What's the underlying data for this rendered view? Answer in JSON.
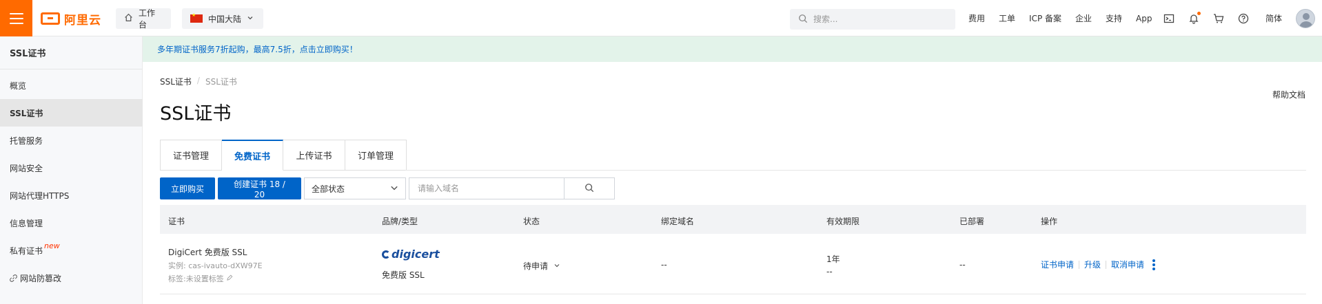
{
  "topbar": {
    "logo_text": "阿里云",
    "workbench": "工作台",
    "region": "中国大陆",
    "search_placeholder": "搜索...",
    "links": [
      "费用",
      "工单",
      "ICP 备案",
      "企业",
      "支持",
      "App"
    ],
    "language": "简体",
    "accent_color": "#ff6a00"
  },
  "sidebar": {
    "title": "SSL证书",
    "items": [
      {
        "label": "概览"
      },
      {
        "label": "SSL证书",
        "active": true
      },
      {
        "label": "托管服务"
      },
      {
        "label": "网站安全"
      },
      {
        "label": "网站代理HTTPS"
      },
      {
        "label": "信息管理"
      },
      {
        "label": "私有证书",
        "badge": "new"
      },
      {
        "label": "网站防篡改"
      }
    ]
  },
  "banner": {
    "text": "多年期证书服务7折起购，最高7.5折，点击立即购买！"
  },
  "breadcrumb": {
    "root": "SSL证书",
    "current": "SSL证书"
  },
  "help_doc": "帮助文档",
  "page_title": "SSL证书",
  "tabs": [
    {
      "label": "证书管理"
    },
    {
      "label": "免费证书",
      "active": true
    },
    {
      "label": "上传证书"
    },
    {
      "label": "订单管理"
    }
  ],
  "toolbar": {
    "buy_label": "立即购买",
    "create_label": "创建证书 18 / 20",
    "status_filter": "全部状态",
    "domain_placeholder": "请输入域名"
  },
  "table": {
    "headers": [
      "证书",
      "品牌/类型",
      "状态",
      "绑定域名",
      "有效期限",
      "已部署",
      "操作"
    ],
    "rows": [
      {
        "name": "DigiCert 免费版 SSL",
        "instance": "实例: cas-ivauto-dXW97E",
        "tag": "标签:未设置标签",
        "brand": "digicert",
        "type": "免费版 SSL",
        "status": "待申请",
        "domain": "--",
        "validity_term": "1年",
        "validity_date": "--",
        "deployed": "--",
        "actions": [
          "证书申请",
          "升级",
          "取消申请"
        ]
      }
    ]
  },
  "colors": {
    "primary": "#0064c8",
    "banner_bg": "#e3f3ea"
  }
}
